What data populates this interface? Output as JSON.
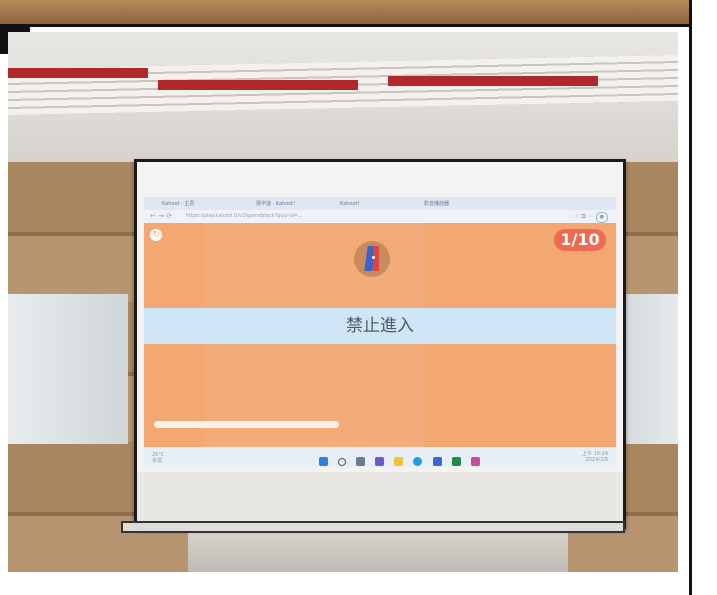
{
  "tabs": [
    {
      "label": "Kahoot · 主頁"
    },
    {
      "label": "猜字謎 · Kahoot!"
    },
    {
      "label": "Kahoot!"
    },
    {
      "label": "影音播放器"
    }
  ],
  "address_bar": {
    "url": "https://play.kahoot.it/v2/gameblock?quiz-id=..."
  },
  "game": {
    "question_counter": "1/10",
    "prompt": "禁止進入",
    "progress": 0.4
  },
  "taskbar": {
    "weather_temp": "26°C",
    "weather_desc": "多雲",
    "time": "上午 10:24",
    "date": "2024/3/8"
  },
  "colors": {
    "game_background": "#f3a872",
    "counter_badge": "#ee6a50",
    "prompt_band": "#cfe6f6"
  }
}
